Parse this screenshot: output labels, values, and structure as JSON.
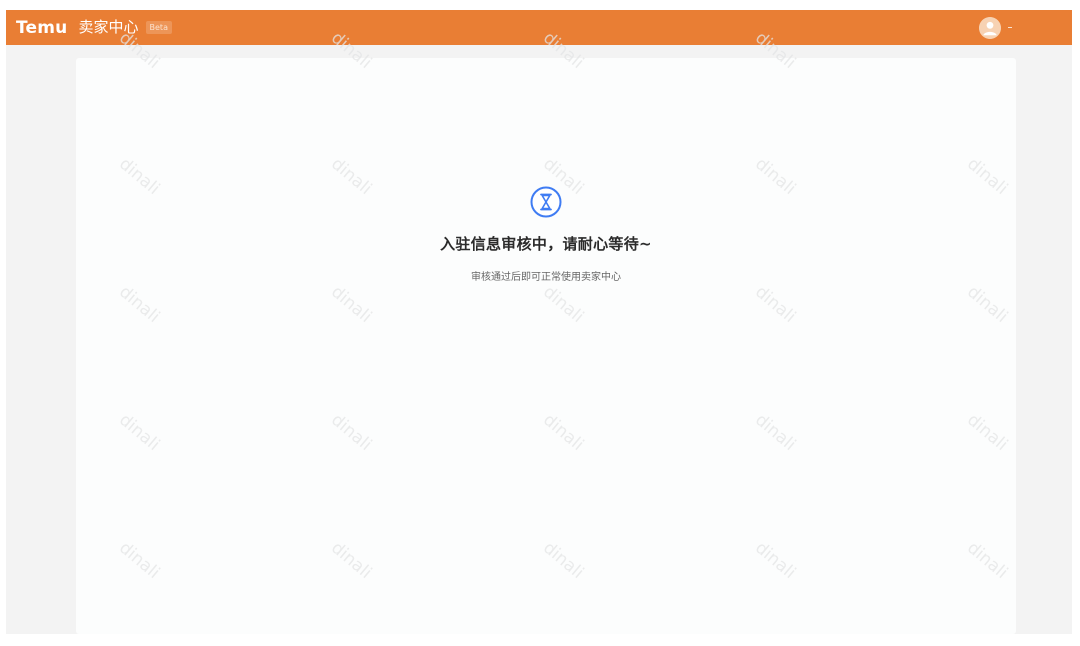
{
  "header": {
    "logo_text": "Temu",
    "center_title": "卖家中心",
    "beta_label": "Beta",
    "user_caret": "-",
    "accent_color": "#e97e34"
  },
  "status": {
    "icon": "hourglass-icon",
    "title": "入驻信息审核中，请耐心等待~",
    "description": "审核通过后即可正常使用卖家中心"
  },
  "watermark": {
    "text": "dinali"
  }
}
